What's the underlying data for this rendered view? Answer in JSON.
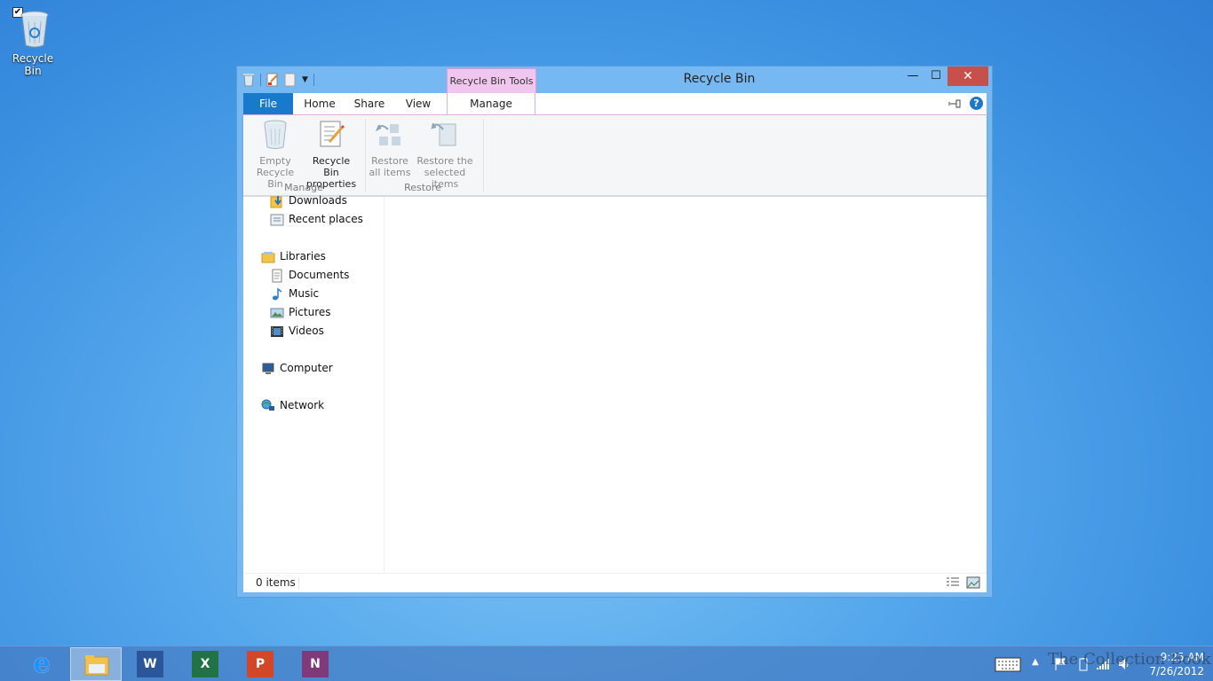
{
  "desktop": {
    "icons": [
      {
        "label": "Recycle Bin",
        "checked": true
      }
    ]
  },
  "window": {
    "title": "Recycle Bin",
    "contextual_tab_header": "Recycle Bin Tools",
    "controls": {
      "minimize": "—",
      "maximize": "☐",
      "close": "✕"
    },
    "tabs": {
      "file": "File",
      "home": "Home",
      "share": "Share",
      "view": "View",
      "manage": "Manage"
    },
    "help_label": "?",
    "ribbon": {
      "manage_group": {
        "label": "Manage",
        "empty_recycle_bin": "Empty\nRecycle Bin",
        "recycle_bin_properties": "Recycle Bin\nproperties"
      },
      "restore_group": {
        "label": "Restore",
        "restore_all": "Restore\nall items",
        "restore_selected": "Restore the\nselected items"
      }
    },
    "nav": {
      "favorites": [
        {
          "label": "Downloads",
          "icon": "downloads-folder-icon"
        },
        {
          "label": "Recent places",
          "icon": "recent-places-icon"
        }
      ],
      "libraries": {
        "label": "Libraries",
        "items": [
          {
            "label": "Documents",
            "icon": "documents-icon"
          },
          {
            "label": "Music",
            "icon": "music-icon"
          },
          {
            "label": "Pictures",
            "icon": "pictures-icon"
          },
          {
            "label": "Videos",
            "icon": "videos-icon"
          }
        ]
      },
      "computer": "Computer",
      "network": "Network"
    },
    "status": {
      "item_count": "0 items"
    }
  },
  "taskbar": {
    "apps": [
      {
        "name": "internet-explorer",
        "glyph": "e",
        "color": "#1e90ff"
      },
      {
        "name": "file-explorer",
        "glyph": "",
        "color": "#f2c14e",
        "active": true
      },
      {
        "name": "word",
        "glyph": "W",
        "color": "#2b579a"
      },
      {
        "name": "excel",
        "glyph": "X",
        "color": "#217346"
      },
      {
        "name": "powerpoint",
        "glyph": "P",
        "color": "#d24726"
      },
      {
        "name": "onenote",
        "glyph": "N",
        "color": "#80397b"
      }
    ],
    "clock": {
      "time": "9:25 AM",
      "date": "7/26/2012"
    }
  },
  "watermark": "The Collection Book",
  "colors": {
    "accent_file_tab": "#1979ca",
    "contextual_tab": "#f0c6ee",
    "close_button": "#c7504b",
    "desktop": "#55a8ec"
  }
}
